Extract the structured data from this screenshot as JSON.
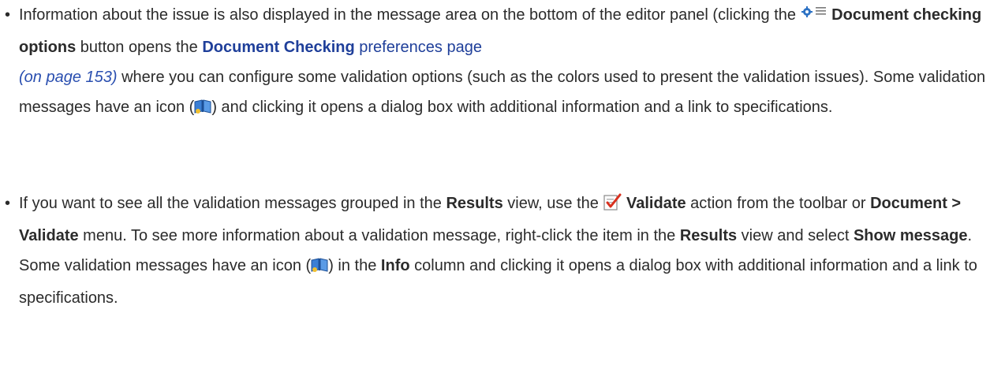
{
  "bullet_symbol": "•",
  "items": [
    {
      "p1": "Information about the issue is also displayed in the message area on the bottom of the editor panel (clicking the ",
      "bold1": "Document checking options",
      "p2": " button opens the ",
      "link_bold": "Document Checking",
      "link_rest": " preferences page",
      "page_ref": "(on page 153)",
      "p3": " where you can configure some validation options (such as the colors used to present the validation issues). Some validation messages have an icon (",
      "p4": ") and clicking it opens a dialog box with additional information and a link to specifications."
    },
    {
      "p1": "If you want to see all the validation messages grouped in the ",
      "bold1": "Results",
      "p2": " view, use the ",
      "bold2": "Validate",
      "p3": " action from the toolbar or ",
      "bold3": "Document > Validate",
      "p4": " menu. To see more information about a validation message, right-click the item in the ",
      "bold4": "Results",
      "p5": " view and select ",
      "bold5": "Show message",
      "p6": ". Some validation messages have an icon (",
      "p7": ") in the ",
      "bold6": "Info",
      "p8": " column and clicking it opens a dialog box with additional information and a link to specifications."
    }
  ],
  "icons": {
    "options": "gear-list-icon",
    "info": "book-info-icon",
    "validate": "validate-check-icon"
  },
  "colors": {
    "link": "#1f3f9a",
    "text": "#2b2b2b",
    "validate_check": "#d9301e"
  }
}
